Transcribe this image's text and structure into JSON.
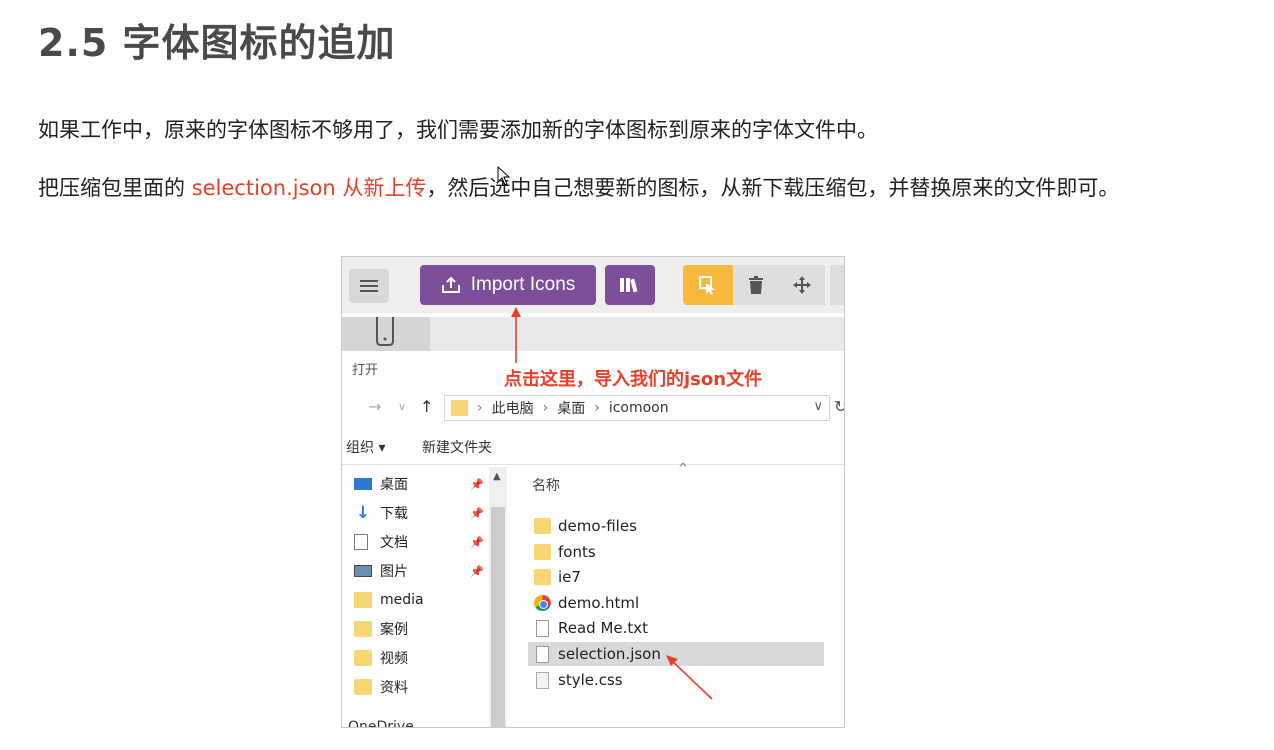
{
  "doc": {
    "title": "2.5 字体图标的追加",
    "para1": "如果工作中，原来的字体图标不够用了，我们需要添加新的字体图标到原来的字体文件中。",
    "para2_prefix": "把压缩包里面的 ",
    "para2_highlight": "selection.json 从新上传",
    "para2_suffix": "，然后选中自己想要新的图标，从新下载压缩包，并替换原来的文件即可。",
    "highlight_color": "#e8402a"
  },
  "screenshot": {
    "toolbar": {
      "import_label": "Import Icons",
      "import_color": "#7d4f9a",
      "select_color": "#f6b93b"
    },
    "dialog_label": "打开",
    "annotation": "点击这里，导入我们的json文件",
    "address": {
      "crumbs": [
        "此电脑",
        "桌面",
        "icomoon"
      ]
    },
    "commands": {
      "organize": "组织 ▾",
      "new_folder": "新建文件夹"
    },
    "nav_items": [
      {
        "label": "桌面",
        "icon": "desktop-icon",
        "pinned": true
      },
      {
        "label": "下载",
        "icon": "download-icon",
        "pinned": true
      },
      {
        "label": "文档",
        "icon": "document-icon",
        "pinned": true
      },
      {
        "label": "图片",
        "icon": "picture-icon",
        "pinned": true
      },
      {
        "label": "media",
        "icon": "folder-icon",
        "pinned": false
      },
      {
        "label": "案例",
        "icon": "folder-icon",
        "pinned": false
      },
      {
        "label": "视频",
        "icon": "folder-icon",
        "pinned": false
      },
      {
        "label": "资料",
        "icon": "folder-icon",
        "pinned": false
      }
    ],
    "onedrive": "OneDrive",
    "column_header": "名称",
    "files": [
      {
        "name": "demo-files",
        "icon": "folder-icon"
      },
      {
        "name": "fonts",
        "icon": "folder-icon"
      },
      {
        "name": "ie7",
        "icon": "folder-icon"
      },
      {
        "name": "demo.html",
        "icon": "chrome-icon"
      },
      {
        "name": "Read Me.txt",
        "icon": "text-file-icon"
      },
      {
        "name": "selection.json",
        "icon": "file-icon",
        "selected": true
      },
      {
        "name": "style.css",
        "icon": "css-file-icon"
      }
    ]
  }
}
